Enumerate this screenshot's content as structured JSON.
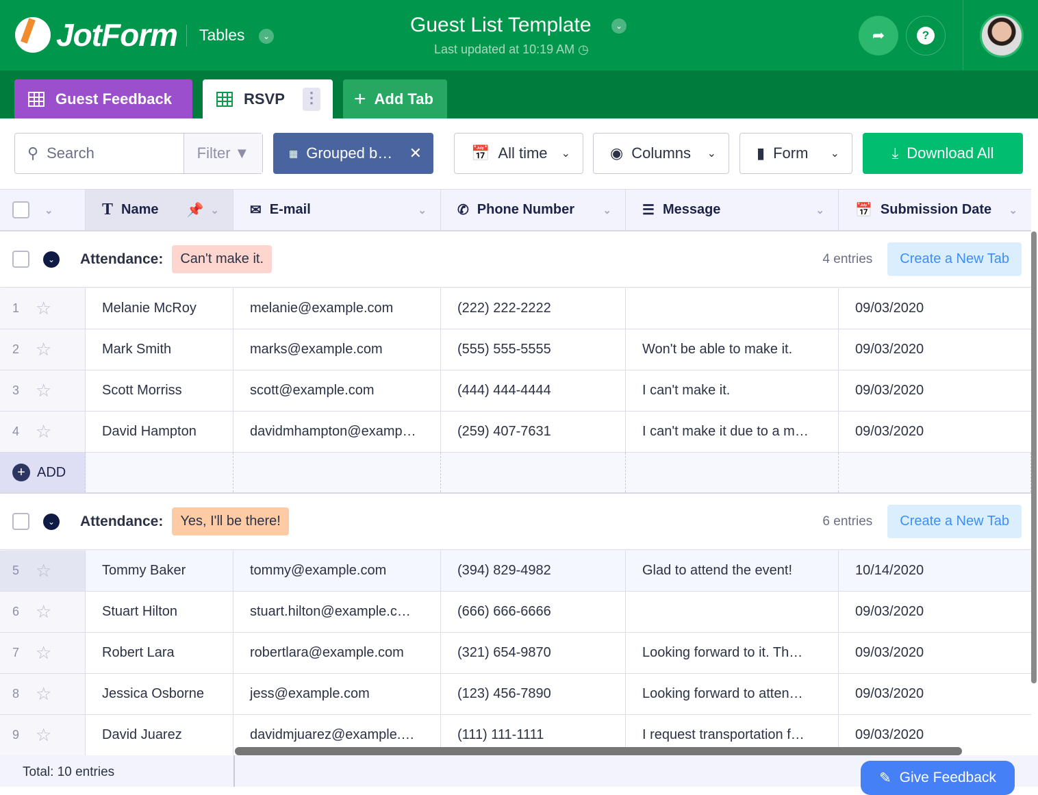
{
  "header": {
    "brand": "JotForm",
    "product": "Tables",
    "title": "Guest List Template",
    "last_updated": "Last updated at 10:19 AM"
  },
  "tabs": [
    {
      "label": "Guest Feedback",
      "color": "#9b4fcc"
    },
    {
      "label": "RSVP",
      "active": true
    },
    {
      "label": "Add Tab"
    }
  ],
  "toolbar": {
    "search_placeholder": "Search",
    "filter": "Filter",
    "grouped": "Grouped b…",
    "all_time": "All time",
    "columns": "Columns",
    "form": "Form",
    "download": "Download All"
  },
  "columns": [
    "Name",
    "E-mail",
    "Phone Number",
    "Message",
    "Submission Date"
  ],
  "groups": [
    {
      "label": "Attendance:",
      "value": "Can't make it.",
      "badge_color": "#ffd6cf",
      "entries": "4 entries",
      "create": "Create a New Tab",
      "rows": [
        {
          "n": "1",
          "name": "Melanie McRoy",
          "email": "melanie@example.com",
          "phone": "(222) 222-2222",
          "message": "",
          "date": "09/03/2020"
        },
        {
          "n": "2",
          "name": "Mark Smith",
          "email": "marks@example.com",
          "phone": "(555) 555-5555",
          "message": "Won't be able to make it.",
          "date": "09/03/2020"
        },
        {
          "n": "3",
          "name": "Scott Morriss",
          "email": "scott@example.com",
          "phone": "(444) 444-4444",
          "message": "I can't make it.",
          "date": "09/03/2020"
        },
        {
          "n": "4",
          "name": "David Hampton",
          "email": "davidmhampton@examp…",
          "phone": "(259) 407-7631",
          "message": "I can't make it due to a m…",
          "date": "09/03/2020"
        }
      ]
    },
    {
      "label": "Attendance:",
      "value": "Yes, I'll be there!",
      "badge_color": "#ffcba4",
      "entries": "6 entries",
      "create": "Create a New Tab",
      "rows": [
        {
          "n": "5",
          "name": "Tommy Baker",
          "email": "tommy@example.com",
          "phone": "(394) 829-4982",
          "message": "Glad to attend the event!",
          "date": "10/14/2020",
          "highlight": true
        },
        {
          "n": "6",
          "name": "Stuart Hilton",
          "email": "stuart.hilton@example.c…",
          "phone": "(666) 666-6666",
          "message": "",
          "date": "09/03/2020"
        },
        {
          "n": "7",
          "name": "Robert Lara",
          "email": "robertlara@example.com",
          "phone": "(321) 654-9870",
          "message": "Looking forward to it. Th…",
          "date": "09/03/2020"
        },
        {
          "n": "8",
          "name": "Jessica Osborne",
          "email": "jess@example.com",
          "phone": "(123) 456-7890",
          "message": "Looking forward to atten…",
          "date": "09/03/2020"
        },
        {
          "n": "9",
          "name": "David Juarez",
          "email": "davidmjuarez@example.…",
          "phone": "(111) 111-1111",
          "message": "I request transportation f…",
          "date": "09/03/2020"
        }
      ]
    }
  ],
  "add_label": "ADD",
  "footer": {
    "total": "Total: 10 entries",
    "feedback": "Give Feedback"
  }
}
